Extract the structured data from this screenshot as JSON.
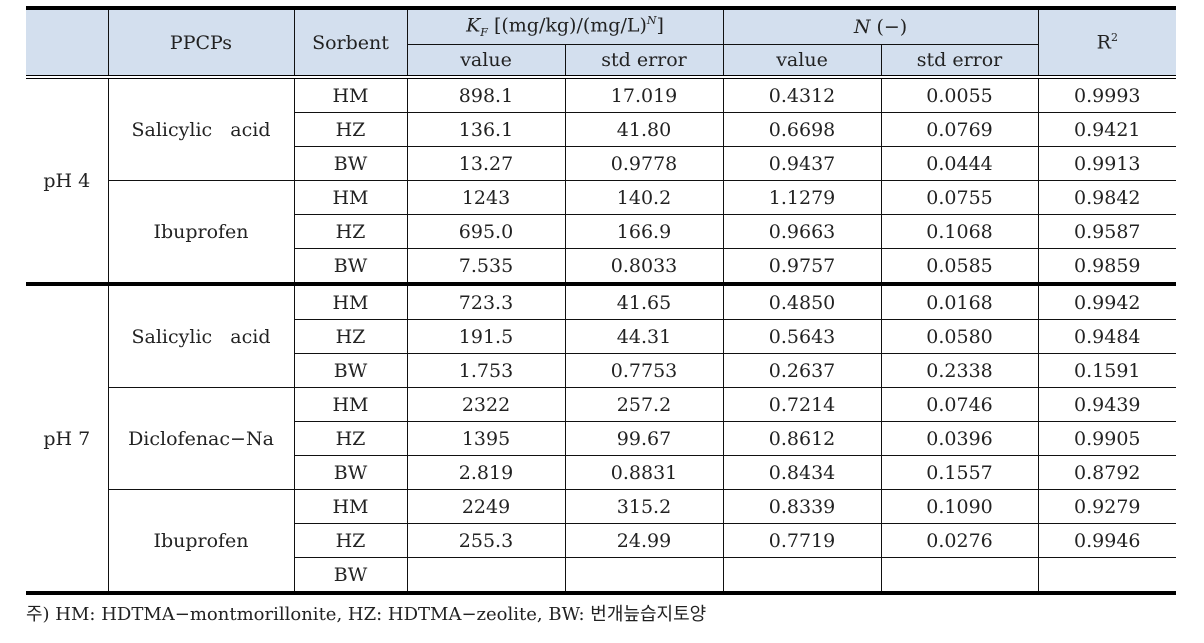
{
  "table": {
    "header": {
      "ph": "",
      "ppcps": "PPCPs",
      "sorbent": "Sorbent",
      "kf_symbol": "K",
      "kf_sub": "F",
      "kf_units": " [(mg/kg)/(mg/L)",
      "kf_units_sup": "N",
      "kf_units_close": "]",
      "n_symbol": "N",
      "n_units": " (−)",
      "r2": "R",
      "r2_sup": "2",
      "value": "value",
      "std_error": "std error"
    },
    "rows": [
      {
        "ph": "pH 4",
        "ppcp": "Salicylic   acid",
        "sorbent": "HM",
        "kf_value": "898.1",
        "kf_se": "17.019",
        "n_value": "0.4312",
        "n_se": "0.0055",
        "r2": "0.9993"
      },
      {
        "ph": "pH 4",
        "ppcp": "Salicylic   acid",
        "sorbent": "HZ",
        "kf_value": "136.1",
        "kf_se": "41.80",
        "n_value": "0.6698",
        "n_se": "0.0769",
        "r2": "0.9421"
      },
      {
        "ph": "pH 4",
        "ppcp": "Salicylic   acid",
        "sorbent": "BW",
        "kf_value": "13.27",
        "kf_se": "0.9778",
        "n_value": "0.9437",
        "n_se": "0.0444",
        "r2": "0.9913"
      },
      {
        "ph": "pH 4",
        "ppcp": "Ibuprofen",
        "sorbent": "HM",
        "kf_value": "1243",
        "kf_se": "140.2",
        "n_value": "1.1279",
        "n_se": "0.0755",
        "r2": "0.9842"
      },
      {
        "ph": "pH 4",
        "ppcp": "Ibuprofen",
        "sorbent": "HZ",
        "kf_value": "695.0",
        "kf_se": "166.9",
        "n_value": "0.9663",
        "n_se": "0.1068",
        "r2": "0.9587"
      },
      {
        "ph": "pH 4",
        "ppcp": "Ibuprofen",
        "sorbent": "BW",
        "kf_value": "7.535",
        "kf_se": "0.8033",
        "n_value": "0.9757",
        "n_se": "0.0585",
        "r2": "0.9859"
      },
      {
        "ph": "pH 7",
        "ppcp": "Salicylic   acid",
        "sorbent": "HM",
        "kf_value": "723.3",
        "kf_se": "41.65",
        "n_value": "0.4850",
        "n_se": "0.0168",
        "r2": "0.9942"
      },
      {
        "ph": "pH 7",
        "ppcp": "Salicylic   acid",
        "sorbent": "HZ",
        "kf_value": "191.5",
        "kf_se": "44.31",
        "n_value": "0.5643",
        "n_se": "0.0580",
        "r2": "0.9484"
      },
      {
        "ph": "pH 7",
        "ppcp": "Salicylic   acid",
        "sorbent": "BW",
        "kf_value": "1.753",
        "kf_se": "0.7753",
        "n_value": "0.2637",
        "n_se": "0.2338",
        "r2": "0.1591"
      },
      {
        "ph": "pH 7",
        "ppcp": "Diclofenac−Na",
        "sorbent": "HM",
        "kf_value": "2322",
        "kf_se": "257.2",
        "n_value": "0.7214",
        "n_se": "0.0746",
        "r2": "0.9439"
      },
      {
        "ph": "pH 7",
        "ppcp": "Diclofenac−Na",
        "sorbent": "HZ",
        "kf_value": "1395",
        "kf_se": "99.67",
        "n_value": "0.8612",
        "n_se": "0.0396",
        "r2": "0.9905"
      },
      {
        "ph": "pH 7",
        "ppcp": "Diclofenac−Na",
        "sorbent": "BW",
        "kf_value": "2.819",
        "kf_se": "0.8831",
        "n_value": "0.8434",
        "n_se": "0.1557",
        "r2": "0.8792"
      },
      {
        "ph": "pH 7",
        "ppcp": "Ibuprofen",
        "sorbent": "HM",
        "kf_value": "2249",
        "kf_se": "315.2",
        "n_value": "0.8339",
        "n_se": "0.1090",
        "r2": "0.9279"
      },
      {
        "ph": "pH 7",
        "ppcp": "Ibuprofen",
        "sorbent": "HZ",
        "kf_value": "255.3",
        "kf_se": "24.99",
        "n_value": "0.7719",
        "n_se": "0.0276",
        "r2": "0.9946"
      },
      {
        "ph": "pH 7",
        "ppcp": "Ibuprofen",
        "sorbent": "BW",
        "kf_value": "",
        "kf_se": "",
        "n_value": "",
        "n_se": "",
        "r2": ""
      }
    ]
  },
  "footnote": "주) HM: HDTMA−montmorillonite, HZ: HDTMA−zeolite, BW: 번개늪습지토양"
}
